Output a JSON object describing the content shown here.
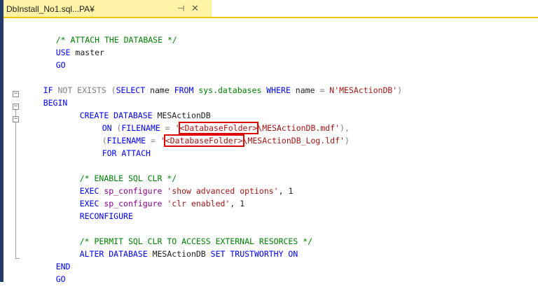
{
  "tab": {
    "title": "DbInstall_No1.sql...PA¥",
    "pin_icon": "pin-icon",
    "close_icon": "close-icon"
  },
  "code": {
    "l1": "/* ATTACH THE DATABASE */",
    "l2_kw": "USE",
    "l2_id": " master",
    "l3": "GO",
    "l5": {
      "if": "IF",
      "not": " NOT EXISTS ",
      "p1": "(",
      "select": "SELECT",
      "name": " name ",
      "from": "FROM",
      "sysdb": " sys.databases ",
      "where": "WHERE",
      "name2": " name ",
      "eq": "=",
      "str": " N'MESActionDB'",
      "p2": ")"
    },
    "l6": "BEGIN",
    "l7_kw": "CREATE DATABASE",
    "l7_id": " MESActionDB",
    "l8": {
      "on": "ON",
      "open": " (",
      "fn": "FILENAME",
      "eq": " = ",
      "q": "'",
      "folder": "<DatabaseFolder>",
      "rest": "\\MESActionDB.mdf'",
      "close": "),"
    },
    "l9": {
      "open": "(",
      "fn": "FILENAME",
      "eq": " = ",
      "q": "'",
      "folder": "<DatabaseFolder>",
      "rest": "\\MESActionDB_Log.ldf'",
      "close": ")"
    },
    "l10": "FOR ATTACH",
    "l12": "/* ENABLE SQL CLR */",
    "l13": {
      "exec": "EXEC",
      "proc": " sp_configure ",
      "str": "'show advanced options'",
      "rest": ", 1"
    },
    "l14": {
      "exec": "EXEC",
      "proc": " sp_configure ",
      "str": "'clr enabled'",
      "rest": ", 1"
    },
    "l15": "RECONFIGURE",
    "l17": "/* PERMIT SQL CLR TO ACCESS EXTERNAL RESORCES */",
    "l18": {
      "kw": "ALTER DATABASE",
      "id": " MESActionDB ",
      "kw2": "SET TRUSTWORTHY ON"
    },
    "l19": "END",
    "l20": "GO"
  }
}
